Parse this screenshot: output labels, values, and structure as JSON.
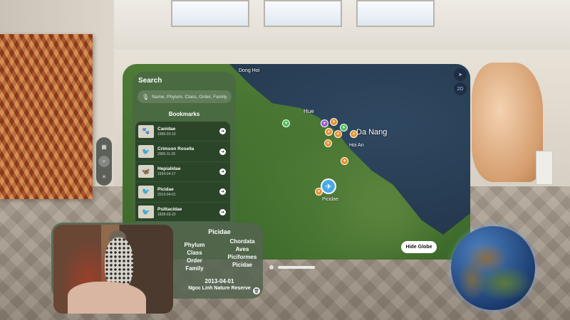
{
  "search": {
    "title": "Search",
    "placeholder": "Name, Phylum, Class, Order, Family."
  },
  "bookmarks": {
    "header": "Bookmarks",
    "items": [
      {
        "name": "Canidae",
        "date": "1995-03-10",
        "icon": "canid-thumb"
      },
      {
        "name": "Crimson Rosella",
        "date": "2006-11-26",
        "icon": "rosella-thumb"
      },
      {
        "name": "Hepialidae",
        "date": "1934-04-17",
        "icon": "moth-thumb"
      },
      {
        "name": "Picidae",
        "date": "2013-04-01",
        "icon": "woodpecker-thumb"
      },
      {
        "name": "Psittacidae",
        "date": "1828-03-22",
        "icon": "parrot-thumb"
      }
    ]
  },
  "map": {
    "labels": {
      "dong_hoi": "Dong Hoi",
      "hue": "Hue",
      "da_nang": "Da Nang",
      "hoi_an": "Hoi An",
      "picidae_pin": "Picidae"
    },
    "controls": {
      "locate_icon": "location-arrow-icon",
      "mode_label": "2D"
    },
    "hide_globe_label": "Hide Globe"
  },
  "detail": {
    "title": "Picidae",
    "taxonomy_labels": [
      "Phylum",
      "Class",
      "Order",
      "Family"
    ],
    "taxonomy_values": [
      "Chordata",
      "Aves",
      "Piciformes",
      "Picidae"
    ],
    "date": "2013-04-01",
    "place": "Ngoc Linh Nature Reserve"
  },
  "side_tabs": [
    "map-icon",
    "search-icon",
    "list-icon"
  ],
  "colors": {
    "panel": "#4a6846",
    "selected_pin": "#4aa8e8",
    "pin_orange": "#e8912a",
    "pin_green": "#4fbf5a",
    "pin_purple": "#9a5ad8"
  }
}
